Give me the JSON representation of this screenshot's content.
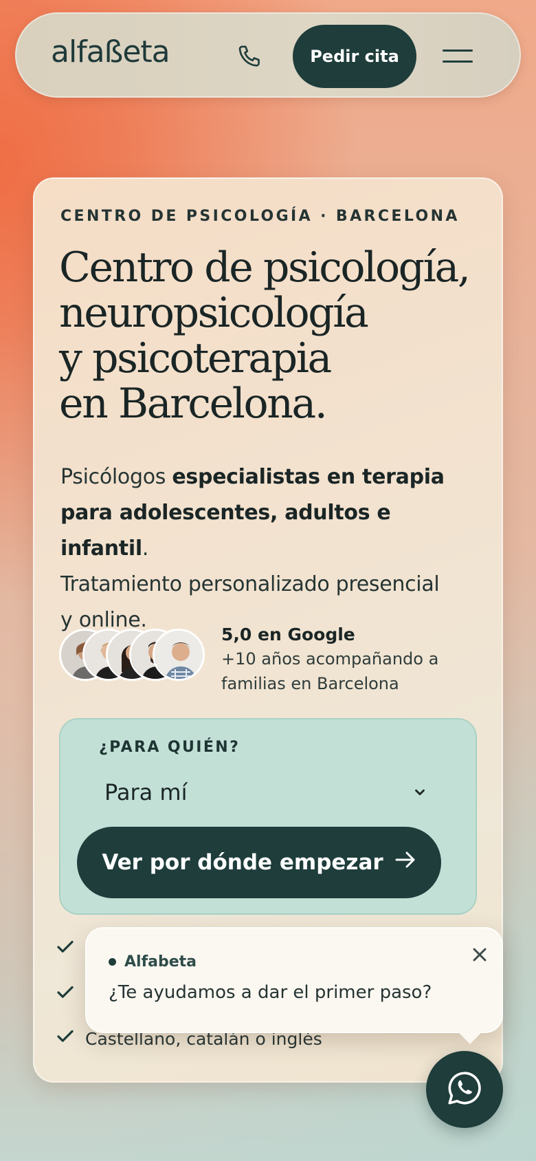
{
  "header": {
    "logo": "alfaßeta",
    "cta_label": "Pedir cita"
  },
  "hero": {
    "eyebrow": "CENTRO DE PSICOLOGÍA · BARCELONA",
    "title_lines": [
      "Centro de psicología,",
      "neuropsicología",
      "y psicoterapia",
      "en Barcelona."
    ],
    "desc_1": "Psicólogos ",
    "desc_bold_1": "especialistas en terapia",
    "desc_bold_2": "para adolescentes, adultos e infantil",
    "desc_2": ".",
    "desc_3": "Tratamiento personalizado presencial",
    "desc_4": "y online."
  },
  "proof": {
    "rating": "5,0 en Google",
    "line_1": "+10 años acompañando a",
    "line_2": "familias en Barcelona"
  },
  "avatars": [
    {
      "name": "avatar-1",
      "bg": "#b59a8a"
    },
    {
      "name": "avatar-2",
      "bg": "#c7a98e"
    },
    {
      "name": "avatar-3",
      "bg": "#8a6a58"
    },
    {
      "name": "avatar-4",
      "bg": "#4a3c36"
    },
    {
      "name": "avatar-5",
      "bg": "#9aa7b8"
    }
  ],
  "selector": {
    "question": "¿PARA QUIÉN?",
    "selected": "Para mí",
    "button": "Ver por dónde empezar"
  },
  "checks": [
    "Castellano, catalán o inglés"
  ],
  "chat": {
    "sender": "Alfabeta",
    "message": "¿Te ayudamos a dar el primer paso?"
  },
  "colors": {
    "brand_dark": "#1e3d3b",
    "accent_orange": "#ef6e45",
    "mint": "#c3e0d7"
  }
}
